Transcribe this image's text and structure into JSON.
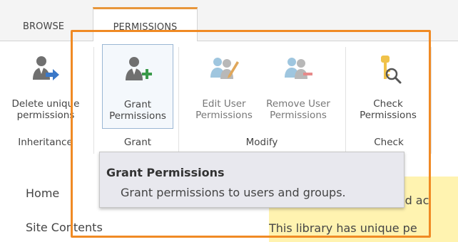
{
  "tabs": {
    "browse": "BROWSE",
    "permissions": "PERMISSIONS"
  },
  "ribbon": {
    "buttons": {
      "delete_unique": "Delete unique permissions",
      "grant": "Grant Permissions",
      "edit_user": "Edit User Permissions",
      "remove_user": "Remove User Permissions",
      "check": "Check Permissions"
    },
    "groups": {
      "inheritance": "Inheritance",
      "grant": "Grant",
      "modify": "Modify",
      "check": "Check"
    }
  },
  "tooltip": {
    "title": "Grant Permissions",
    "description": "Grant permissions to users and groups."
  },
  "nav": {
    "home": "Home",
    "site_contents": "Site Contents"
  },
  "banner": {
    "line1": "ited ac",
    "line2": "This library has unique pe"
  },
  "colors": {
    "accent_orange": "#f08a24",
    "tab_border": "#e8963a",
    "banner_bg": "#fff3b0",
    "tooltip_bg": "#e8e8ee"
  }
}
